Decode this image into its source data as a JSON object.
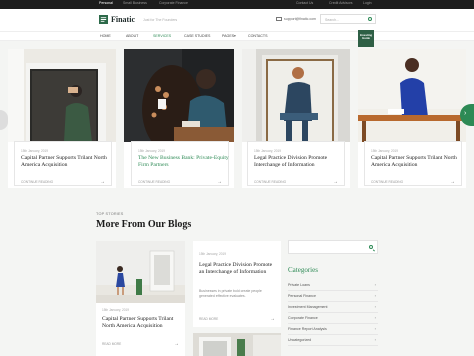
{
  "topbar": {
    "links": [
      "Personal",
      "Small Business",
      "Corporate Finance"
    ],
    "right": [
      "Contact Us",
      "Credit Advisors",
      "Login"
    ]
  },
  "header": {
    "logo": "Finatic",
    "tagline": "Just for The Founders",
    "email": "support@finatic.com",
    "search_placeholder": "Search...",
    "badge": "Investing Guide"
  },
  "nav": [
    "HOME",
    "ABOUT",
    "SERVICES",
    "CASE STUDIES",
    "PAGES",
    "CONTACTS"
  ],
  "slides": [
    {
      "date": "15th January, 2019",
      "title": "Capital Partner Supports Trilant North America Acquisition",
      "more": "CONTINUE READING"
    },
    {
      "date": "15th January, 2019",
      "title": "The New Business Bank: Private-Equity Firm Partners",
      "more": "CONTINUE READING"
    },
    {
      "date": "15th January, 2019",
      "title": "Legal Practice Division Promote Interchange of Information",
      "more": "CONTINUE READING"
    },
    {
      "date": "15th January, 2019",
      "title": "Capital Partner Supports Trilant North America Acquisition",
      "more": "CONTINUE READING"
    }
  ],
  "section": {
    "kicker": "TOP STORIES",
    "title": "More From Our Blogs"
  },
  "blogs": [
    {
      "date": "15th January, 2019",
      "title": "Capital Partner Supports Trilant North America Acquisition",
      "more": "READ MORE"
    },
    {
      "date": "15th January, 2019",
      "title": "Legal Practice Division Promote an Interchange of Information",
      "excerpt": "Businesses in private bold create people generated effective evaluates.",
      "more": "READ MORE"
    }
  ],
  "sidebar": {
    "categories_title": "Categories",
    "categories": [
      "Private Loans",
      "Personal Finance",
      "Investment Management",
      "Corporate Finance",
      "Finance Report Analysis",
      "Uncategorized"
    ]
  },
  "colors": {
    "accent": "#2d8a55",
    "dark": "#1d1d1d"
  }
}
